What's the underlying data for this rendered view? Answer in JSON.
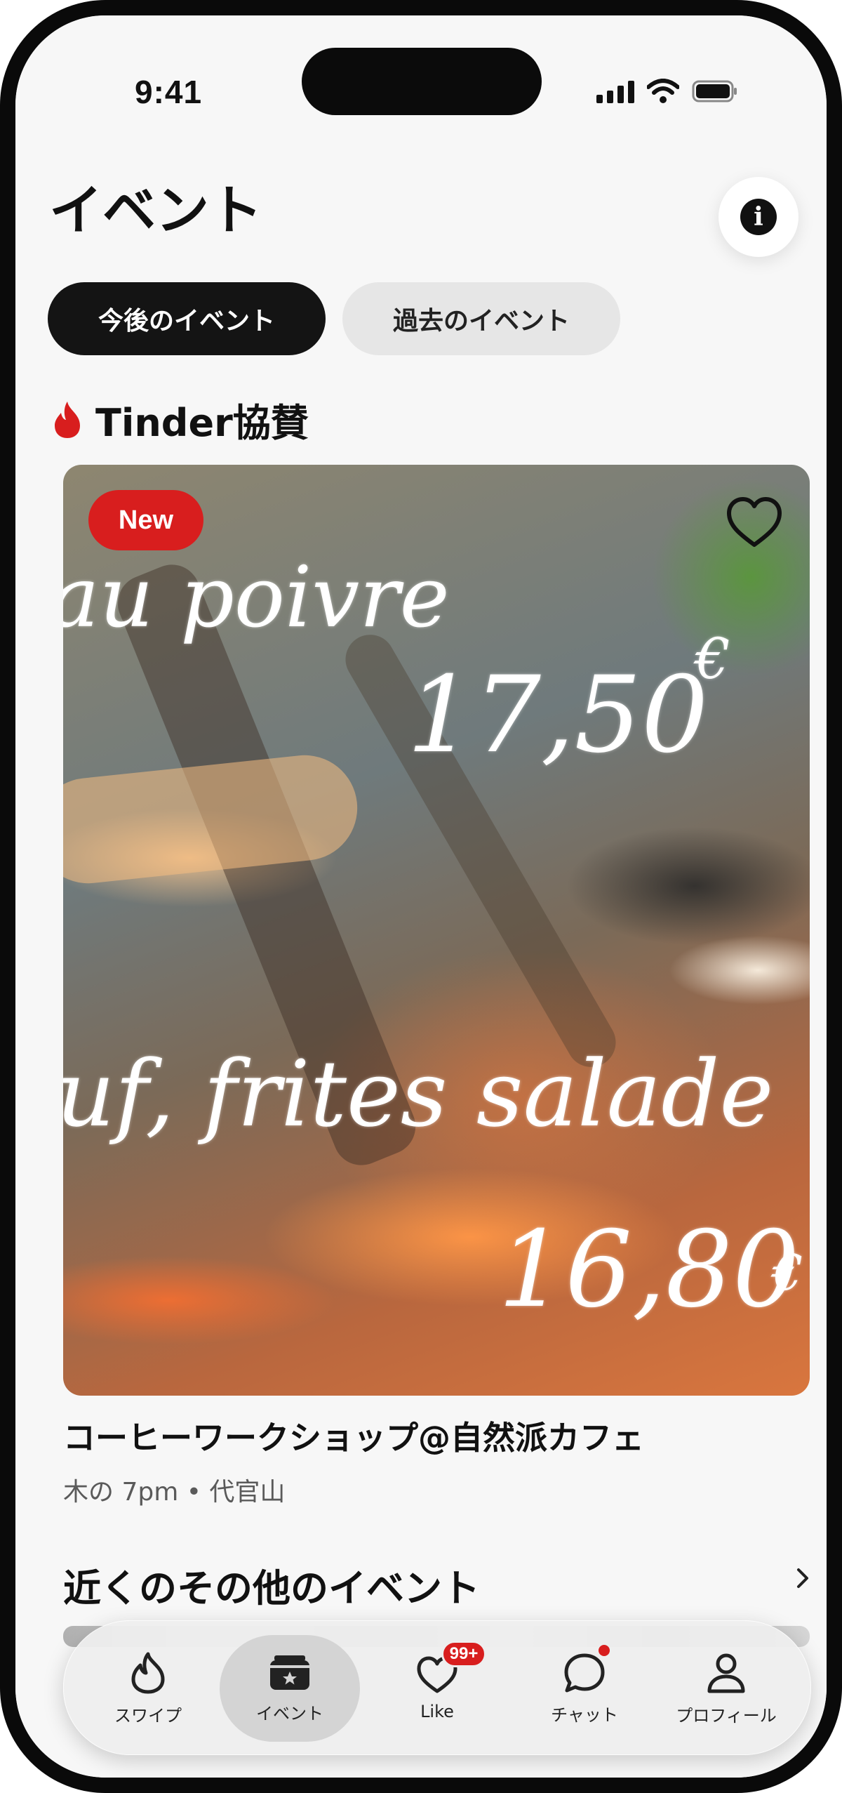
{
  "status_bar": {
    "time": "9:41"
  },
  "header": {
    "title": "イベント"
  },
  "tabs": [
    {
      "label": "今後のイベント",
      "selected": true
    },
    {
      "label": "過去のイベント",
      "selected": false
    }
  ],
  "sponsored_section": {
    "title": "Tinder協賛",
    "icon": "flame-icon"
  },
  "featured_event": {
    "badge": "New",
    "image_text": {
      "line1": "au poivre",
      "line2": "17,50",
      "euro1": "€",
      "line3": "uf, frites salade",
      "line4": "16,80",
      "euro2": "€"
    },
    "title": "コーヒーワークショップ@自然派カフェ",
    "meta": "木の 7pm • 代官山"
  },
  "nearby_section": {
    "title": "近くのその他のイベント"
  },
  "bottom_nav": {
    "items": [
      {
        "label": "スワイプ",
        "icon": "flame-outline-icon",
        "active": false
      },
      {
        "label": "イベント",
        "icon": "ticket-star-icon",
        "active": true
      },
      {
        "label": "Like",
        "icon": "heart-outline-icon",
        "active": false,
        "badge": "99+"
      },
      {
        "label": "チャット",
        "icon": "chat-bubble-icon",
        "active": false,
        "dot": true
      },
      {
        "label": "プロフィール",
        "icon": "person-icon",
        "active": false
      }
    ]
  },
  "colors": {
    "accent": "#d81e1e",
    "active_tab_bg": "#141414",
    "inactive_tab_bg": "#e6e6e6",
    "background": "#f7f7f7"
  }
}
